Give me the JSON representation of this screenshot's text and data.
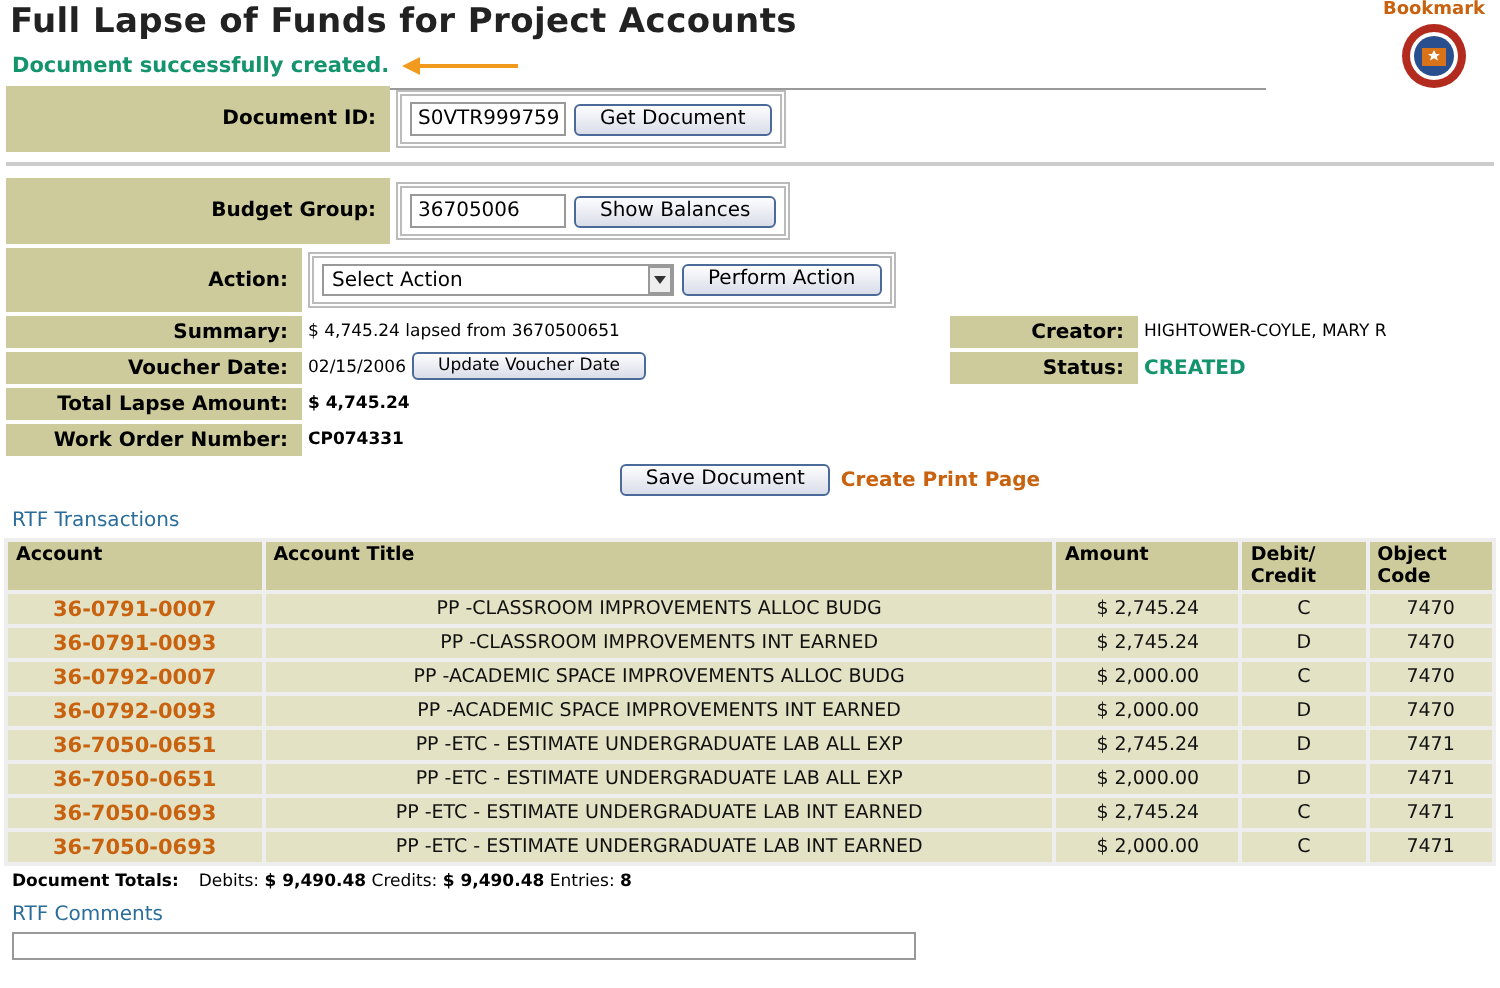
{
  "page": {
    "title": "Full Lapse of Funds for Project Accounts",
    "bookmark": "Bookmark"
  },
  "message": "Document successfully created.",
  "document": {
    "label": "Document ID:",
    "value": "S0VTR999759",
    "button": "Get Document"
  },
  "budget": {
    "label": "Budget Group:",
    "value": "36705006",
    "button": "Show Balances"
  },
  "action": {
    "label": "Action:",
    "select": "Select Action",
    "button": "Perform Action"
  },
  "details_left": [
    {
      "kind": "text",
      "label": "Summary:",
      "value": "$ 4,745.24 lapsed from 3670500651"
    },
    {
      "kind": "button",
      "label": "Voucher Date:",
      "value": "02/15/2006",
      "button": "Update Voucher Date"
    },
    {
      "kind": "bold",
      "label": "Total Lapse Amount:",
      "value": "$ 4,745.24"
    },
    {
      "kind": "bold",
      "label": "Work Order Number:",
      "value": "CP074331"
    }
  ],
  "details_right": [
    {
      "kind": "text",
      "label": "Creator:",
      "value": "HIGHTOWER-COYLE, MARY R"
    },
    {
      "kind": "status",
      "label": "Status:",
      "value": "CREATED"
    }
  ],
  "save_button": "Save Document",
  "print_link": "Create Print Page",
  "transactions_link": "RTF Transactions",
  "table": {
    "columns": [
      "Account",
      "Account Title",
      "Amount",
      "Debit/ Credit",
      "Object Code"
    ],
    "rows": [
      [
        "36-0791-0007",
        "PP -CLASSROOM IMPROVEMENTS ALLOC BUDG",
        "$ 2,745.24",
        "C",
        "7470"
      ],
      [
        "36-0791-0093",
        "PP -CLASSROOM IMPROVEMENTS INT EARNED",
        "$ 2,745.24",
        "D",
        "7470"
      ],
      [
        "36-0792-0007",
        "PP -ACADEMIC SPACE IMPROVEMENTS ALLOC BUDG",
        "$ 2,000.00",
        "C",
        "7470"
      ],
      [
        "36-0792-0093",
        "PP -ACADEMIC SPACE IMPROVEMENTS INT EARNED",
        "$ 2,000.00",
        "D",
        "7470"
      ],
      [
        "36-7050-0651",
        "PP -ETC - ESTIMATE UNDERGRADUATE LAB ALL EXP",
        "$ 2,745.24",
        "D",
        "7471"
      ],
      [
        "36-7050-0651",
        "PP -ETC - ESTIMATE UNDERGRADUATE LAB ALL EXP",
        "$ 2,000.00",
        "D",
        "7471"
      ],
      [
        "36-7050-0693",
        "PP -ETC - ESTIMATE UNDERGRADUATE LAB INT EARNED",
        "$ 2,745.24",
        "C",
        "7471"
      ],
      [
        "36-7050-0693",
        "PP -ETC - ESTIMATE UNDERGRADUATE LAB INT EARNED",
        "$ 2,000.00",
        "C",
        "7471"
      ]
    ]
  },
  "totals": {
    "label": "Document Totals:",
    "text": "Debits: **$ 9,490.48** Credits: **$ 9,490.48** Entries: **8**"
  },
  "comments_link": "RTF Comments"
}
